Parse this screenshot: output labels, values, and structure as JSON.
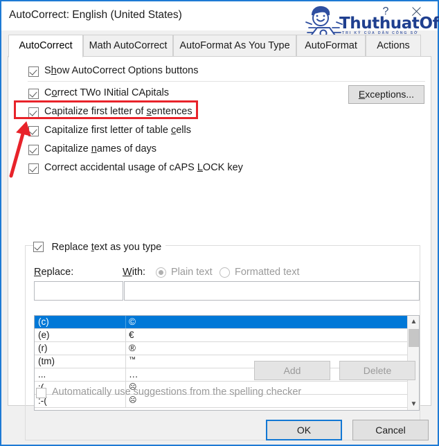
{
  "window": {
    "title": "AutoCorrect: English (United States)",
    "help_icon": "question-mark-icon",
    "close_icon": "close-icon"
  },
  "watermark": {
    "brand": "ThuthuatOffice",
    "tagline": "TRI KỶ CỦA DÂN CÔNG SỞ"
  },
  "tabs": [
    {
      "label": "AutoCorrect",
      "active": true
    },
    {
      "label": "Math AutoCorrect",
      "active": false
    },
    {
      "label": "AutoFormat As You Type",
      "active": false
    },
    {
      "label": "AutoFormat",
      "active": false
    },
    {
      "label": "Actions",
      "active": false
    }
  ],
  "options": [
    {
      "label": "Show AutoCorrect Options buttons",
      "checked": true,
      "accel": "h",
      "accel_index": 1
    },
    {
      "label": "Correct TWo INitial CApitals",
      "checked": true,
      "accel": "o",
      "accel_index": 1
    },
    {
      "label": "Capitalize first letter of sentences",
      "checked": true,
      "accel": "s",
      "accel_index": 25
    },
    {
      "label": "Capitalize first letter of table cells",
      "checked": true,
      "accel": "c",
      "accel_index": 30
    },
    {
      "label": "Capitalize names of days",
      "checked": true,
      "accel": "n",
      "accel_index": 11
    },
    {
      "label": "Correct accidental usage of cAPS LOCK key",
      "checked": true,
      "accel": "L",
      "accel_index": 32
    }
  ],
  "exceptions_button": "Exceptions...",
  "replace_group": {
    "checkbox_label": "Replace text as you type",
    "checked": true,
    "replace_label": "Replace:",
    "with_label": "With:",
    "replace_value": "",
    "with_value": "",
    "radios": [
      {
        "label": "Plain text",
        "selected": true
      },
      {
        "label": "Formatted text",
        "selected": false
      }
    ],
    "entries": [
      {
        "replace": "(c)",
        "with": "©",
        "selected": true
      },
      {
        "replace": "(e)",
        "with": "€",
        "selected": false
      },
      {
        "replace": "(r)",
        "with": "®",
        "selected": false
      },
      {
        "replace": "(tm)",
        "with": "™",
        "selected": false
      },
      {
        "replace": "...",
        "with": "…",
        "selected": false
      },
      {
        "replace": ":(",
        "with": "☹",
        "selected": false
      },
      {
        "replace": ":-(",
        "with": "☹",
        "selected": false
      }
    ],
    "scrollbar": {
      "up_icon": "chevron-up-icon",
      "down_icon": "chevron-down-icon"
    },
    "add_button": "Add",
    "delete_button": "Delete",
    "spelling_checkbox": "Automatically use suggestions from the spelling checker",
    "spelling_checked": false
  },
  "footer": {
    "ok_label": "OK",
    "cancel_label": "Cancel"
  },
  "colors": {
    "accent": "#0078d7",
    "annotation_red": "#e8232a",
    "brand_blue": "#1f3f8f",
    "dialog_border": "#1e7ad4"
  }
}
